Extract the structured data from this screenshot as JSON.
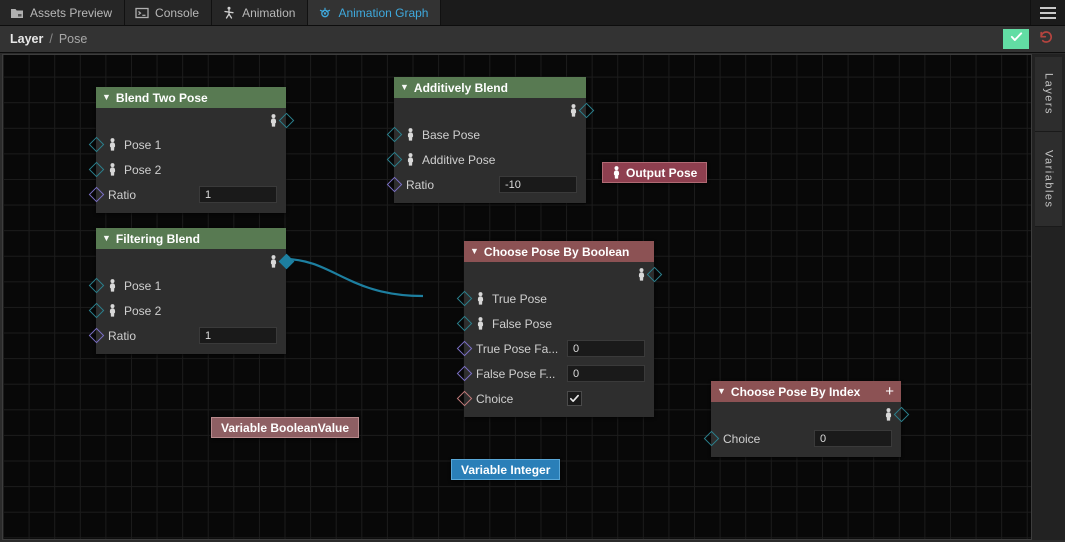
{
  "tabs": [
    {
      "label": "Assets Preview",
      "icon": "folder-icon",
      "active": false
    },
    {
      "label": "Console",
      "icon": "console-icon",
      "active": false
    },
    {
      "label": "Animation",
      "icon": "animation-icon",
      "active": false
    },
    {
      "label": "Animation Graph",
      "icon": "animation-graph-icon",
      "active": true
    }
  ],
  "menu": {
    "icon": "hamburger-icon"
  },
  "breadcrumb": {
    "root": "Layer",
    "separator": "/",
    "leaf": "Pose"
  },
  "toolbar": {
    "apply_icon": "checkmark-icon",
    "revert_icon": "undo-icon"
  },
  "side_panel": {
    "layers_label": "Layers",
    "variables_label": "Variables"
  },
  "colors": {
    "accent_tab": "#3fa9dd",
    "header_green": "#587a52",
    "header_red": "#8c5254",
    "pill_output": "#8e3f4f",
    "pill_variable_bool": "#8e5f63",
    "pill_variable_int": "#2a7fb8",
    "wire": "#1d7fa0",
    "apply_green": "#62dda4",
    "revert_red": "#b4443f"
  },
  "nodes": {
    "blend_two_pose": {
      "title": "Blend Two Pose",
      "rows": [
        {
          "label": "Pose 1",
          "port": "pose"
        },
        {
          "label": "Pose 2",
          "port": "pose"
        },
        {
          "label": "Ratio",
          "port": "float",
          "value": "1"
        }
      ]
    },
    "filtering_blend": {
      "title": "Filtering Blend",
      "rows": [
        {
          "label": "Pose 1",
          "port": "pose"
        },
        {
          "label": "Pose 2",
          "port": "pose"
        },
        {
          "label": "Ratio",
          "port": "float",
          "value": "1"
        }
      ]
    },
    "additively_blend": {
      "title": "Additively Blend",
      "rows": [
        {
          "label": "Base Pose",
          "port": "pose"
        },
        {
          "label": "Additive Pose",
          "port": "pose"
        },
        {
          "label": "Ratio",
          "port": "float",
          "value": "-10"
        }
      ]
    },
    "choose_pose_by_boolean": {
      "title": "Choose Pose By Boolean",
      "rows": [
        {
          "label": "True Pose",
          "port": "pose"
        },
        {
          "label": "False Pose",
          "port": "pose"
        },
        {
          "label": "True Pose Fa...",
          "port": "float",
          "value": "0"
        },
        {
          "label": "False Pose F...",
          "port": "float",
          "value": "0"
        },
        {
          "label": "Choice",
          "port": "bool",
          "value": "checked"
        }
      ]
    },
    "choose_pose_by_index": {
      "title": "Choose Pose By Index",
      "add_label": "+",
      "rows": [
        {
          "label": "Choice",
          "port": "int",
          "value": "0"
        }
      ]
    },
    "output_pose": {
      "title": "Output Pose"
    },
    "variable_boolean": {
      "title": "Variable BooleanValue"
    },
    "variable_integer": {
      "title": "Variable Integer"
    }
  }
}
